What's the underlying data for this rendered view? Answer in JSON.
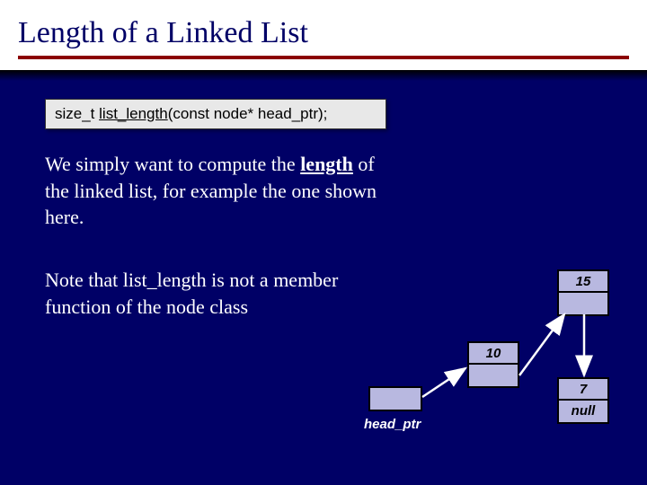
{
  "title": "Length of a Linked List",
  "code": {
    "return_type": "size_t ",
    "fn": "list_length",
    "params": "(const node* head_ptr);"
  },
  "para1_a": "We simply want to compute the ",
  "para1_emph": "length",
  "para1_b": " of the linked list, for example the one shown here.",
  "para2": "Note that list_length is not a member function of the node class",
  "headptr_label": "head_ptr",
  "nodes": {
    "n1": "10",
    "n2": "15",
    "n3": "7",
    "null": "null"
  }
}
